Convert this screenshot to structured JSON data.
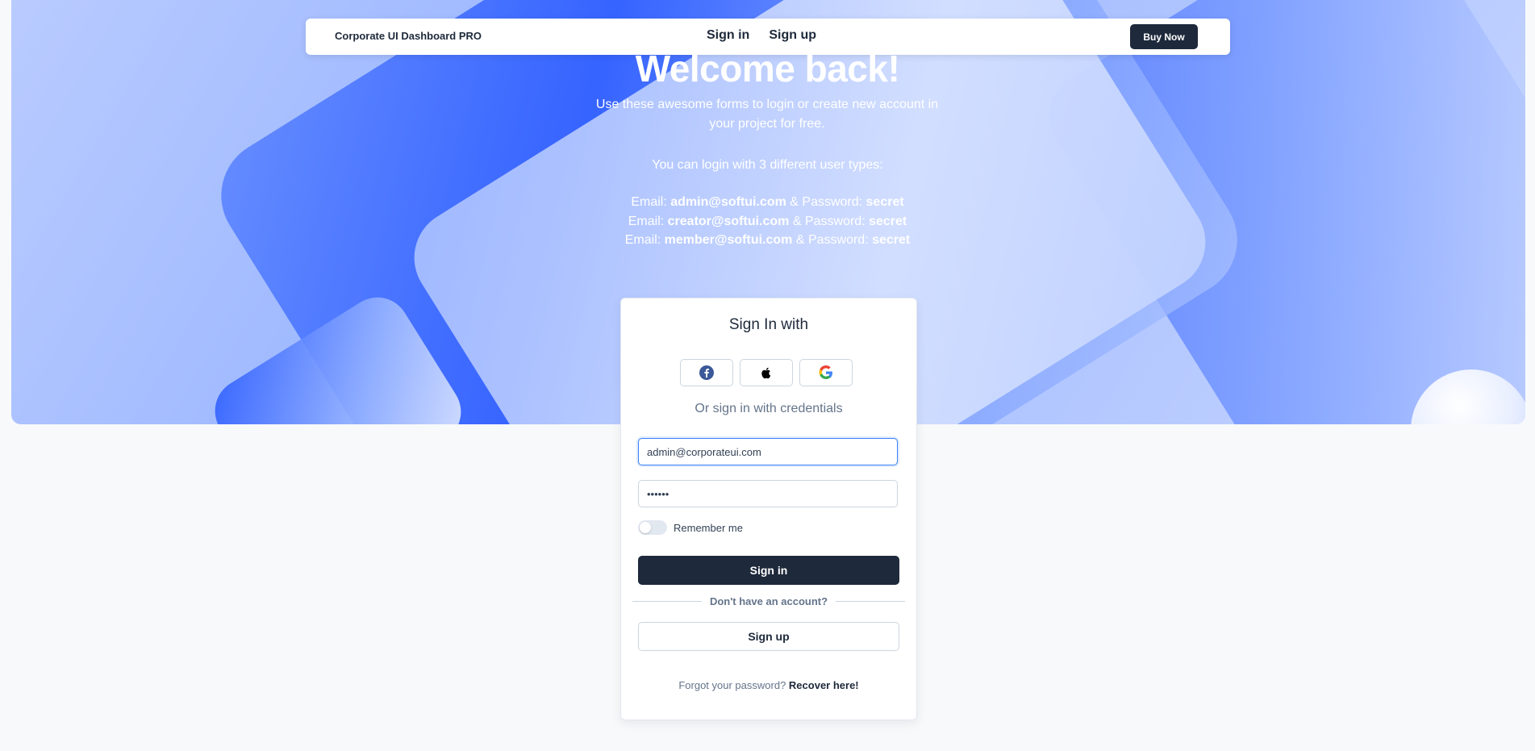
{
  "nav": {
    "brand": "Corporate UI Dashboard PRO",
    "links": [
      "Sign in",
      "Sign up"
    ],
    "buy_label": "Buy Now"
  },
  "hero": {
    "title": "Welcome back!",
    "subtitle": "Use these awesome forms to login or create new account in your project for free.",
    "hint": "You can login with 3 different user types:",
    "credentials": [
      {
        "prefix": "Email: ",
        "email": "admin@softui.com",
        "mid": " & Password: ",
        "password": "secret"
      },
      {
        "prefix": "Email: ",
        "email": "creator@softui.com",
        "mid": " & Password: ",
        "password": "secret"
      },
      {
        "prefix": "Email: ",
        "email": "member@softui.com",
        "mid": " & Password: ",
        "password": "secret"
      }
    ]
  },
  "card": {
    "title": "Sign In with",
    "social_icons": [
      "facebook-icon",
      "apple-icon",
      "google-icon"
    ],
    "or_text": "Or sign in with credentials",
    "email_value": "admin@corporateui.com",
    "password_value": "••••••",
    "remember_label": "Remember me",
    "signin_label": "Sign in",
    "divider_text": "Don't have an account?",
    "signup_label": "Sign up",
    "forgot_text": "Forgot your password? ",
    "recover_link": "Recover here!"
  },
  "colors": {
    "primary": "#1e293b",
    "focus": "#3b82f6",
    "hero_blue": "#1448ff"
  }
}
